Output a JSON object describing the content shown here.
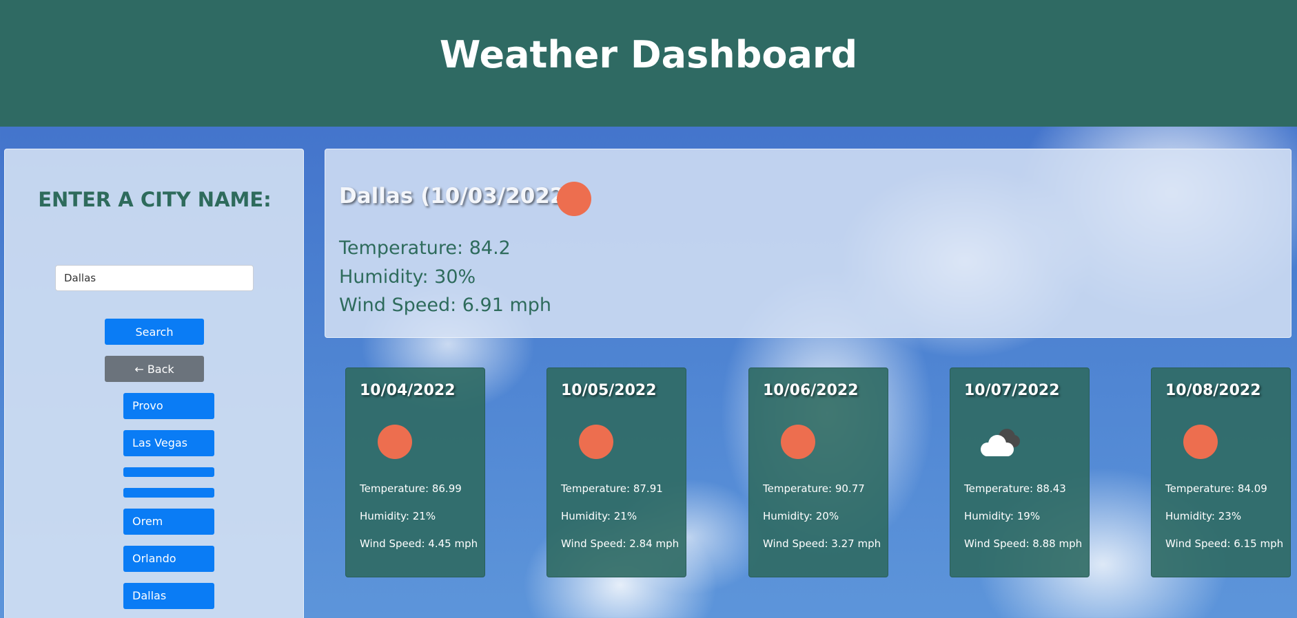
{
  "header": {
    "title": "Weather Dashboard"
  },
  "sidebar": {
    "heading": "ENTER A CITY NAME:",
    "search_value": "Dallas",
    "search_button": "Search",
    "back_button": "← Back",
    "history": [
      "Provo",
      "Las Vegas",
      "",
      "",
      "Orem",
      "Orlando",
      "Dallas"
    ]
  },
  "current": {
    "title": "Dallas (10/03/2022)",
    "icon": "sun-icon",
    "temperature": "Temperature: 84.2",
    "humidity": "Humidity: 30%",
    "wind": "Wind Speed: 6.91 mph"
  },
  "forecast": [
    {
      "date": "10/04/2022",
      "icon": "sun-icon",
      "temperature": "Temperature: 86.99",
      "humidity": "Humidity: 21%",
      "wind": "Wind Speed: 4.45 mph"
    },
    {
      "date": "10/05/2022",
      "icon": "sun-icon",
      "temperature": "Temperature: 87.91",
      "humidity": "Humidity: 21%",
      "wind": "Wind Speed: 2.84 mph"
    },
    {
      "date": "10/06/2022",
      "icon": "sun-icon",
      "temperature": "Temperature: 90.77",
      "humidity": "Humidity: 20%",
      "wind": "Wind Speed: 3.27 mph"
    },
    {
      "date": "10/07/2022",
      "icon": "cloud-icon",
      "temperature": "Temperature: 88.43",
      "humidity": "Humidity: 19%",
      "wind": "Wind Speed: 8.88 mph"
    },
    {
      "date": "10/08/2022",
      "icon": "sun-icon",
      "temperature": "Temperature: 84.09",
      "humidity": "Humidity: 23%",
      "wind": "Wind Speed: 6.15 mph"
    }
  ],
  "colors": {
    "header_bg": "#2f6a63",
    "accent_green": "#2e6b5c",
    "primary_button": "#0a7cf5",
    "secondary_button": "#6b737c",
    "sun": "#ed6e4f"
  }
}
